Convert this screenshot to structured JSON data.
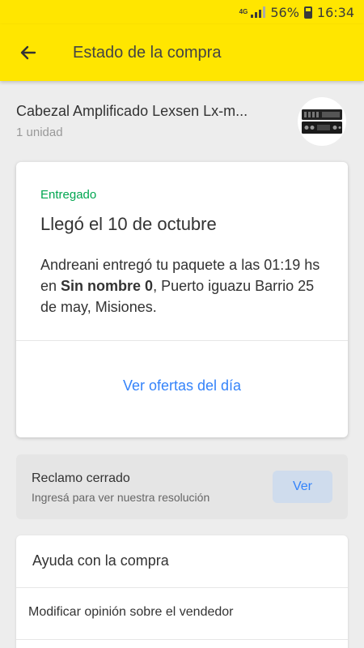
{
  "status_bar": {
    "network": "4G",
    "battery": "56%",
    "time": "16:34"
  },
  "app_bar": {
    "title": "Estado de la compra"
  },
  "product": {
    "title": "Cabezal Amplificado Lexsen Lx-m...",
    "quantity": "1 unidad"
  },
  "delivery_card": {
    "status": "Entregado",
    "title": "Llegó el 10 de octubre",
    "desc_before": "Andreani entregó tu paquete a las 01:19 hs en ",
    "desc_bold": "Sin nombre 0",
    "desc_after": ", Puerto iguazu Barrio 25 de may, Misiones.",
    "link_label": "Ver ofertas del día"
  },
  "claim": {
    "title": "Reclamo cerrado",
    "subtitle": "Ingresá para ver nuestra resolución",
    "button_label": "Ver"
  },
  "help": {
    "title": "Ayuda con la compra",
    "items": [
      "Modificar opinión sobre el vendedor"
    ]
  },
  "colors": {
    "brand_yellow": "#ffe600",
    "status_green": "#00a650",
    "link_blue": "#3483fa"
  }
}
